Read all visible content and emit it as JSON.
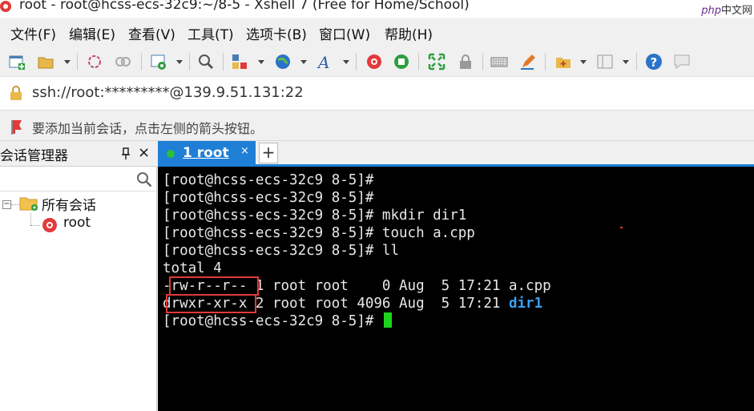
{
  "window": {
    "title": "root - root@hcss-ecs-32c9:~/8-5 - Xshell 7 (Free for Home/School)",
    "watermark_brand": "php",
    "watermark_text": "中文网"
  },
  "menu": [
    "文件(F)",
    "编辑(E)",
    "查看(V)",
    "工具(T)",
    "选项卡(B)",
    "窗口(W)",
    "帮助(H)"
  ],
  "toolbar": {
    "icons": [
      "new-session-icon",
      "open-folder-icon",
      "reconnect-icon",
      "disconnect-icon",
      "properties-icon",
      "find-icon",
      "transfer-icon",
      "globe-icon",
      "font-icon",
      "xshell-icon",
      "xftp-icon",
      "fullscreen-icon",
      "lock-icon",
      "keyboard-icon",
      "compose-icon",
      "add-icon",
      "layout-icon",
      "help-icon",
      "chat-icon"
    ]
  },
  "address": {
    "value": "ssh://root:*********@139.9.51.131:22"
  },
  "hint": {
    "text": "要添加当前会话，点击左侧的箭头按钮。"
  },
  "sidebar": {
    "title": "会话管理器",
    "pin": "⊥",
    "close": "×",
    "tree_toggle": "−",
    "root_label": "所有会话",
    "session_label": "root"
  },
  "tabs": {
    "active_label": "1 root",
    "close": "×",
    "new": "+"
  },
  "colors": {
    "accent": "#1f7fd6",
    "terminal_bg": "#000000",
    "cursor": "#1ed31e",
    "dir": "#3a9ff0",
    "highlight": "#e23a3a"
  },
  "terminal": {
    "lines": [
      "[root@hcss-ecs-32c9 8-5]#",
      "[root@hcss-ecs-32c9 8-5]#",
      "[root@hcss-ecs-32c9 8-5]# mkdir dir1",
      "[root@hcss-ecs-32c9 8-5]# touch a.cpp",
      "[root@hcss-ecs-32c9 8-5]# ll",
      "total 4",
      "-rw-r--r-- 1 root root    0 Aug  5 17:21 a.cpp",
      "drwxr-xr-x 2 root root 4096 Aug  5 17:21 ",
      "[root@hcss-ecs-32c9 8-5]# "
    ],
    "dir_name": "dir1"
  }
}
